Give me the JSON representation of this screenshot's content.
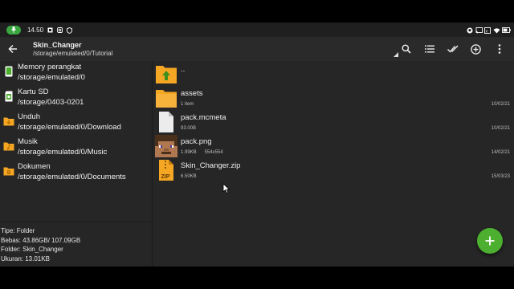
{
  "status_bar": {
    "time": "14.50",
    "icons": [
      "mic-icon",
      "notification-icon",
      "instagram-icon",
      "shield-icon",
      "github-icon",
      "cast-icon",
      "sim-card-icon",
      "wifi-icon",
      "battery-icon"
    ]
  },
  "toolbar": {
    "title": "Skin_Changer",
    "path": "/storage/emulated/0/Tutorial",
    "actions": [
      "search-icon",
      "list-view-icon",
      "select-all-icon",
      "add-icon",
      "more-vert-icon"
    ]
  },
  "storages": [
    {
      "name": "Memory perangkat",
      "path": "/storage/emulated/0",
      "icon": "phone-storage-icon"
    },
    {
      "name": "Kartu SD",
      "path": "/storage/0403-0201",
      "icon": "sd-card-icon"
    },
    {
      "name": "Unduh",
      "path": "/storage/emulated/0/Download",
      "icon": "download-folder-icon"
    },
    {
      "name": "Musik",
      "path": "/storage/emulated/0/Music",
      "icon": "music-folder-icon"
    },
    {
      "name": "Dokumen",
      "path": "/storage/emulated/0/Documents",
      "icon": "documents-folder-icon"
    }
  ],
  "info": {
    "type": "Tipe: Folder",
    "free": "Bebas: 43.86GB/ 107.09GB",
    "folder": "Folder: Skin_Changer",
    "size": "Ukuran: 13.01KB"
  },
  "files": [
    {
      "name": "..",
      "meta": "",
      "dims": "",
      "date": "",
      "icon": "parent-folder-icon"
    },
    {
      "name": "assets",
      "meta": "1 item",
      "dims": "",
      "date": "10/02/21",
      "icon": "folder-icon"
    },
    {
      "name": "pack.mcmeta",
      "meta": "93.00B",
      "dims": "",
      "date": "10/02/21",
      "icon": "file-icon"
    },
    {
      "name": "pack.png",
      "meta": "1.99KB",
      "dims": "554x554",
      "date": "14/02/21",
      "icon": "image-thumbnail-icon"
    },
    {
      "name": "Skin_Changer.zip",
      "meta": "6.50KB",
      "dims": "",
      "date": "15/03/23",
      "icon": "zip-icon"
    }
  ],
  "colors": {
    "accent": "#4caf2f",
    "folder": "#f5a623",
    "background": "#262626"
  }
}
